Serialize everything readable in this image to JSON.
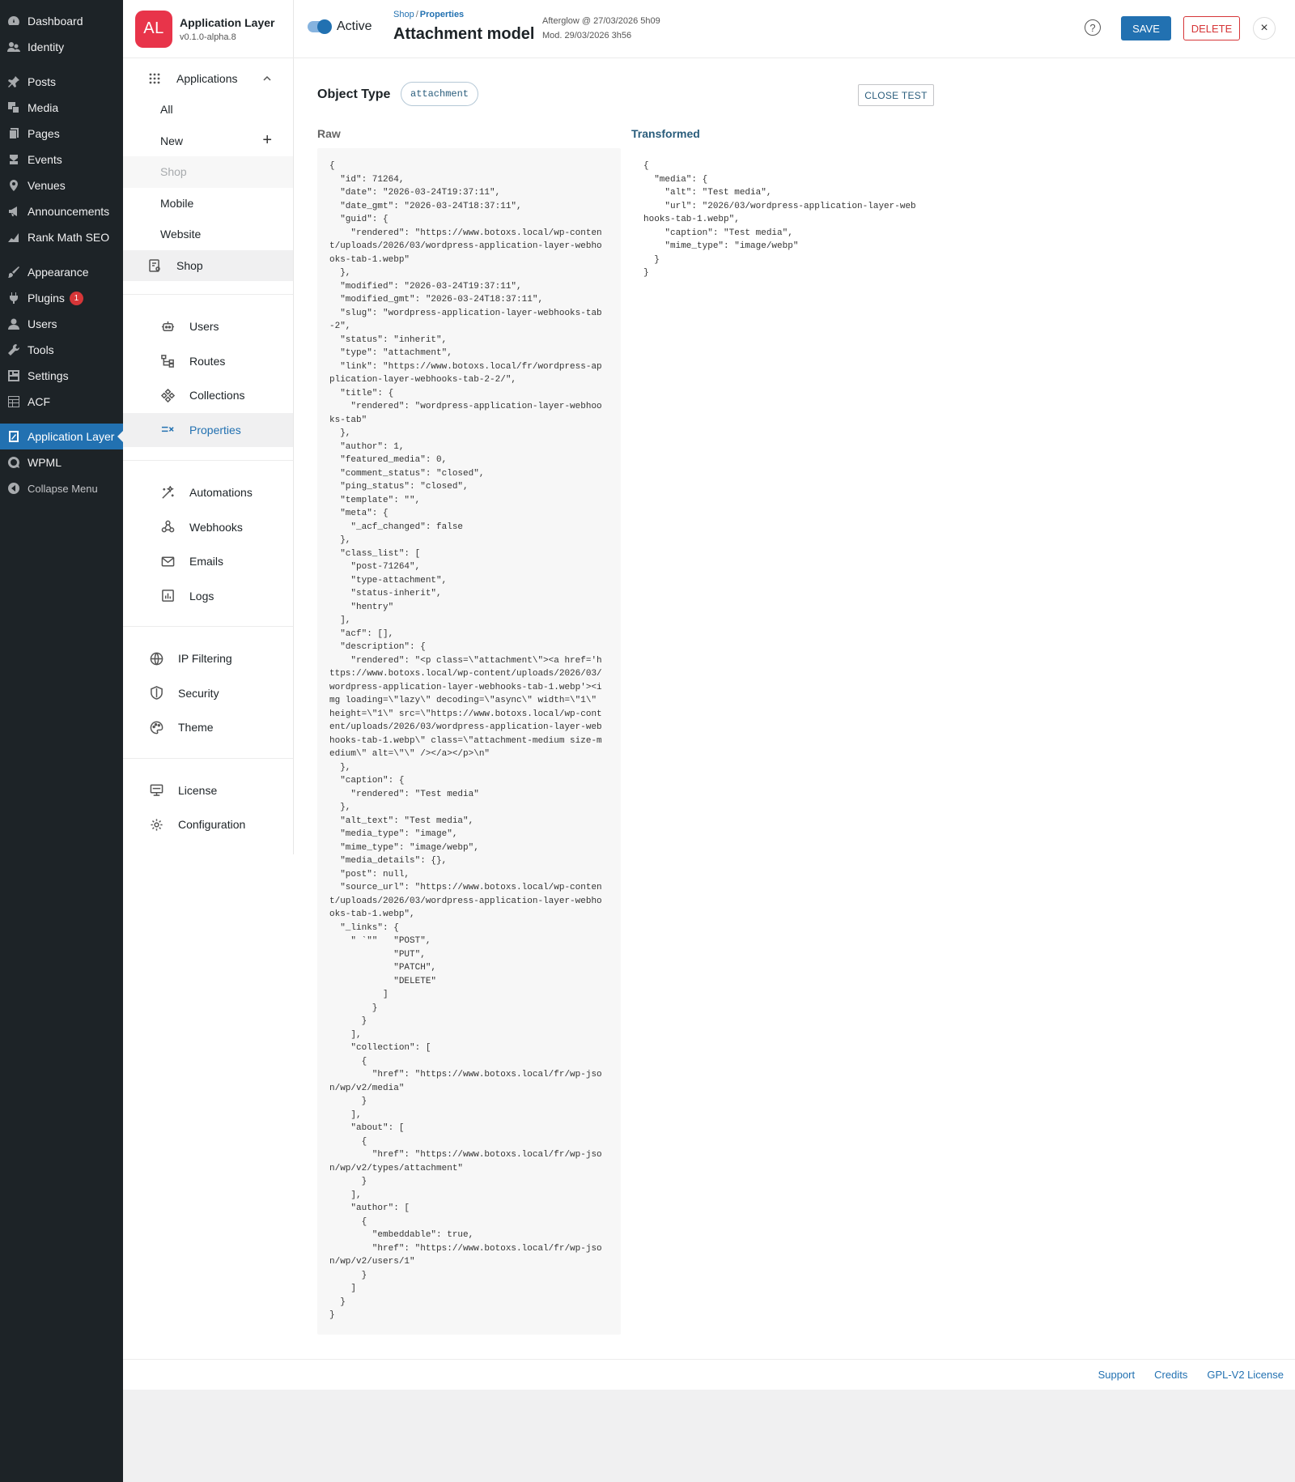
{
  "wp_menu": {
    "items": [
      {
        "label": "Dashboard",
        "icon": "dashboard-icon"
      },
      {
        "label": "Identity",
        "icon": "identity-icon"
      },
      {
        "label": "Posts",
        "icon": "pin-icon"
      },
      {
        "label": "Media",
        "icon": "media-icon"
      },
      {
        "label": "Pages",
        "icon": "pages-icon"
      },
      {
        "label": "Events",
        "icon": "events-icon"
      },
      {
        "label": "Venues",
        "icon": "location-icon"
      },
      {
        "label": "Announcements",
        "icon": "megaphone-icon"
      },
      {
        "label": "Rank Math SEO",
        "icon": "chart-icon"
      },
      {
        "label": "Appearance",
        "icon": "brush-icon"
      },
      {
        "label": "Plugins",
        "icon": "plug-icon",
        "badge": "1"
      },
      {
        "label": "Users",
        "icon": "user-icon"
      },
      {
        "label": "Tools",
        "icon": "wrench-icon"
      },
      {
        "label": "Settings",
        "icon": "settings-icon"
      },
      {
        "label": "ACF",
        "icon": "grid-icon"
      },
      {
        "label": "Application Layer",
        "icon": "app-layer-icon"
      },
      {
        "label": "WPML",
        "icon": "wpml-icon"
      },
      {
        "label": "Collapse Menu",
        "icon": "collapse-icon"
      }
    ]
  },
  "brand": {
    "logo_text": "AL",
    "name": "Application Layer",
    "version": "v0.1.0-alpha.8"
  },
  "nav": {
    "applications": "Applications",
    "app_items": [
      {
        "label": "All"
      },
      {
        "label": "New",
        "action": "+"
      },
      {
        "label": "Shop"
      },
      {
        "label": "Mobile"
      },
      {
        "label": "Website"
      },
      {
        "label": "Shop"
      }
    ],
    "group1": [
      {
        "label": "Users",
        "icon": "robot-icon"
      },
      {
        "label": "Routes",
        "icon": "routes-icon"
      },
      {
        "label": "Collections",
        "icon": "collections-icon"
      },
      {
        "label": "Properties",
        "icon": "properties-icon"
      }
    ],
    "group2": [
      {
        "label": "Automations",
        "icon": "magic-wand-icon"
      },
      {
        "label": "Webhooks",
        "icon": "webhook-icon"
      },
      {
        "label": "Emails",
        "icon": "mail-icon"
      },
      {
        "label": "Logs",
        "icon": "logs-icon"
      }
    ],
    "group3": [
      {
        "label": "IP Filtering",
        "icon": "globe-icon"
      },
      {
        "label": "Security",
        "icon": "shield-icon"
      },
      {
        "label": "Theme",
        "icon": "palette-icon"
      }
    ],
    "group4": [
      {
        "label": "License",
        "icon": "license-icon"
      },
      {
        "label": "Configuration",
        "icon": "gear-icon"
      }
    ]
  },
  "header": {
    "toggle_label": "Active",
    "breadcrumb": {
      "parent": "Shop",
      "separator": "/",
      "current": "Properties"
    },
    "title": "Attachment model",
    "meta_line1": "Afterglow @ 27/03/2026 5h09",
    "meta_line2": "Mod. 29/03/2026 3h56",
    "save": "SAVE",
    "delete": "DELETE",
    "close": "×",
    "help": "?"
  },
  "main": {
    "object_type_label": "Object Type",
    "object_type_value": "attachment",
    "close_test": "CLOSE TEST",
    "raw_label": "Raw",
    "transformed_label": "Transformed",
    "raw_code": "{\n  \"id\": 71264,\n  \"date\": \"2026-03-24T19:37:11\",\n  \"date_gmt\": \"2026-03-24T18:37:11\",\n  \"guid\": {\n    \"rendered\": \"https://www.botoxs.local/wp-conten\nt/uploads/2026/03/wordpress-application-layer-webho\noks-tab-1.webp\"\n  },\n  \"modified\": \"2026-03-24T19:37:11\",\n  \"modified_gmt\": \"2026-03-24T18:37:11\",\n  \"slug\": \"wordpress-application-layer-webhooks-tab\n-2\",\n  \"status\": \"inherit\",\n  \"type\": \"attachment\",\n  \"link\": \"https://www.botoxs.local/fr/wordpress-ap\nplication-layer-webhooks-tab-2-2/\",\n  \"title\": {\n    \"rendered\": \"wordpress-application-layer-webhoo\nks-tab\"\n  },\n  \"author\": 1,\n  \"featured_media\": 0,\n  \"comment_status\": \"closed\",\n  \"ping_status\": \"closed\",\n  \"template\": \"\",\n  \"meta\": {\n    \"_acf_changed\": false\n  },\n  \"class_list\": [\n    \"post-71264\",\n    \"type-attachment\",\n    \"status-inherit\",\n    \"hentry\"\n  ],\n  \"acf\": [],\n  \"description\": {\n    \"rendered\": \"<p class=\\\"attachment\\\"><a href='h\nttps://www.botoxs.local/wp-content/uploads/2026/03/\nwordpress-application-layer-webhooks-tab-1.webp'><i\nmg loading=\\\"lazy\\\" decoding=\\\"async\\\" width=\\\"1\\\"\nheight=\\\"1\\\" src=\\\"https://www.botoxs.local/wp-cont\nent/uploads/2026/03/wordpress-application-layer-web\nhooks-tab-1.webp\\\" class=\\\"attachment-medium size-m\nedium\\\" alt=\\\"\\\" /></a></p>\\n\"\n  },\n  \"caption\": {\n    \"rendered\": \"Test media\"\n  },\n  \"alt_text\": \"Test media\",\n  \"media_type\": \"image\",\n  \"mime_type\": \"image/webp\",\n  \"media_details\": {},\n  \"post\": null,\n  \"source_url\": \"https://www.botoxs.local/wp-conten\nt/uploads/2026/03/wordpress-application-layer-webho\noks-tab-1.webp\",\n  \"_links\": {\n    \" `\"\"   \"POST\",\n            \"PUT\",\n            \"PATCH\",\n            \"DELETE\"\n          ]\n        }\n      }\n    ],\n    \"collection\": [\n      {\n        \"href\": \"https://www.botoxs.local/fr/wp-jso\nn/wp/v2/media\"\n      }\n    ],\n    \"about\": [\n      {\n        \"href\": \"https://www.botoxs.local/fr/wp-jso\nn/wp/v2/types/attachment\"\n      }\n    ],\n    \"author\": [\n      {\n        \"embeddable\": true,\n        \"href\": \"https://www.botoxs.local/fr/wp-jso\nn/wp/v2/users/1\"\n      }\n    ]\n  }\n}",
    "transformed_code": "{\n  \"media\": {\n    \"alt\": \"Test media\",\n    \"url\": \"2026/03/wordpress-application-layer-web\nhooks-tab-1.webp\",\n    \"caption\": \"Test media\",\n    \"mime_type\": \"image/webp\"\n  }\n}"
  },
  "footer": {
    "links": [
      "Support",
      "Credits",
      "GPL-V2 License"
    ]
  },
  "colors": {
    "accent": "#2271b1",
    "danger": "#d63638",
    "brand": "#e8344a",
    "sidebar": "#1d2327"
  }
}
